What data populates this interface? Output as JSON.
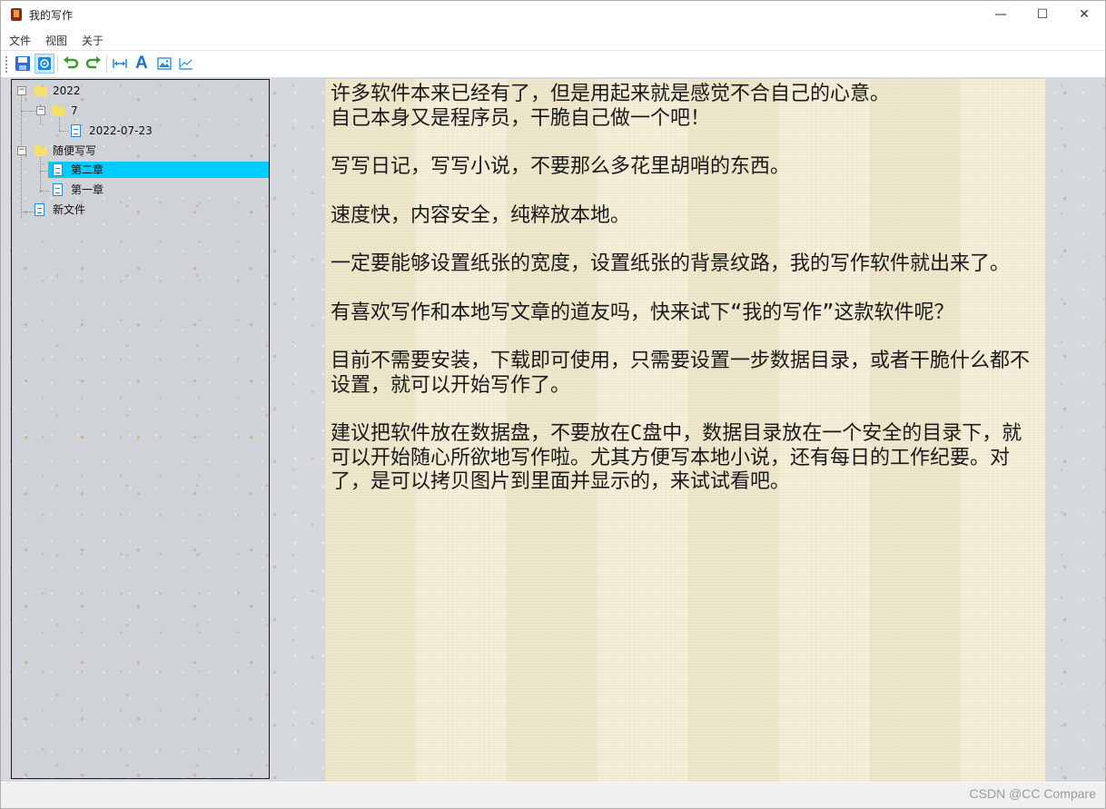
{
  "window": {
    "title": "我的写作",
    "minimize_glyph": "—",
    "maximize_glyph": "☐",
    "close_glyph": "✕"
  },
  "menu": {
    "items": [
      "文件",
      "视图",
      "关于"
    ]
  },
  "toolbar": {
    "buttons": [
      {
        "name": "save-icon",
        "active": false
      },
      {
        "name": "settings-icon",
        "active": true
      },
      {
        "name": "undo-icon",
        "active": false
      },
      {
        "name": "redo-icon",
        "active": false
      },
      {
        "name": "paper-width-icon",
        "active": false
      },
      {
        "name": "font-icon",
        "active": false,
        "glyph": "A"
      },
      {
        "name": "image-icon",
        "active": false
      },
      {
        "name": "chart-icon",
        "active": false
      }
    ]
  },
  "tree": {
    "nodes": [
      {
        "label": "2022",
        "type": "folder",
        "expanded": true,
        "selected": false
      },
      {
        "label": "7",
        "type": "folder",
        "expanded": true,
        "selected": false
      },
      {
        "label": "2022-07-23",
        "type": "file",
        "selected": false
      },
      {
        "label": "随便写写",
        "type": "folder",
        "expanded": true,
        "selected": false
      },
      {
        "label": "第二章",
        "type": "file",
        "selected": true
      },
      {
        "label": "第一章",
        "type": "file",
        "selected": false
      },
      {
        "label": "新文件",
        "type": "file",
        "selected": false
      }
    ],
    "expander_glyph": "−"
  },
  "document": {
    "paragraphs": [
      "许多软件本来已经有了，但是用起来就是感觉不合自己的心意。\n自己本身又是程序员，干脆自己做一个吧！",
      "写写日记，写写小说，不要那么多花里胡哨的东西。",
      "速度快，内容安全，纯粹放本地。",
      "一定要能够设置纸张的宽度，设置纸张的背景纹路，我的写作软件就出来了。",
      "有喜欢写作和本地写文章的道友吗，快来试下“我的写作”这款软件呢？",
      "目前不需要安装，下载即可使用，只需要设置一步数据目录，或者干脆什么都不设置，就可以开始写作了。",
      "建议把软件放在数据盘，不要放在C盘中，数据目录放在一个安全的目录下，就可以开始随心所欲地写作啦。尤其方便写本地小说，还有每日的工作纪要。对了，是可以拷贝图片到里面并显示的，来试试看吧。"
    ]
  },
  "statusbar": {
    "watermark": "CSDN @CC Compare",
    "grip_glyph": "⠿"
  },
  "colors": {
    "selection": "#00ccff",
    "paper": "#f5efd9",
    "tree_border": "#1a1a1a",
    "icon_blue": "#2a8ad6",
    "icon_green": "#3a9a2a",
    "folder_yellow": "#f5e06a"
  }
}
